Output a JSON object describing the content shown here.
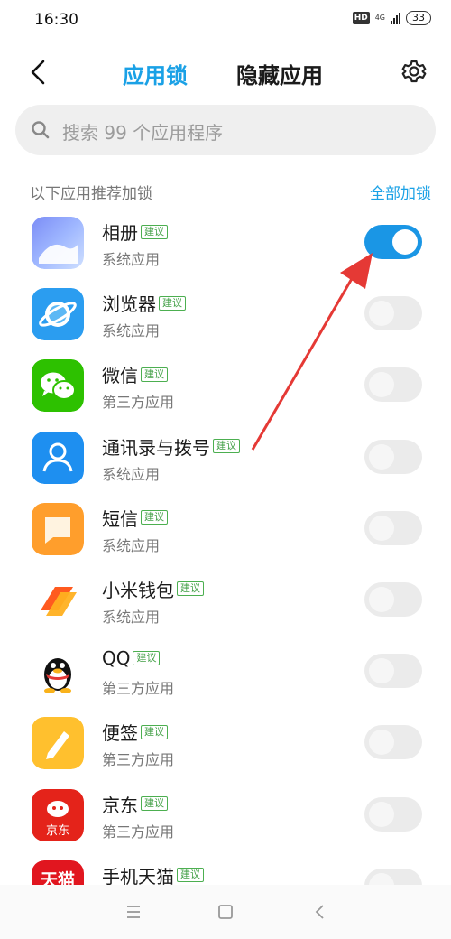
{
  "status_bar": {
    "time": "16:30",
    "hd": "HD",
    "network": "4G",
    "battery": "33"
  },
  "header": {
    "tab_applock": "应用锁",
    "tab_hidden": "隐藏应用",
    "icons": [
      "back-arrow-icon",
      "gear-icon"
    ]
  },
  "search": {
    "placeholder": "搜索 99 个应用程序"
  },
  "section": {
    "title": "以下应用推荐加锁",
    "lock_all": "全部加锁"
  },
  "badge_text": "建议",
  "apps": [
    {
      "name": "相册",
      "type": "系统应用",
      "badge": "建议",
      "locked": true
    },
    {
      "name": "浏览器",
      "type": "系统应用",
      "badge": "建议",
      "locked": false
    },
    {
      "name": "微信",
      "type": "第三方应用",
      "badge": "建议",
      "locked": false
    },
    {
      "name": "通讯录与拨号",
      "type": "系统应用",
      "badge": "建议",
      "locked": false
    },
    {
      "name": "短信",
      "type": "系统应用",
      "badge": "建议",
      "locked": false
    },
    {
      "name": "小米钱包",
      "type": "系统应用",
      "badge": "建议",
      "locked": false
    },
    {
      "name": "QQ",
      "type": "第三方应用",
      "badge": "建议",
      "locked": false
    },
    {
      "name": "便签",
      "type": "第三方应用",
      "badge": "建议",
      "locked": false
    },
    {
      "name": "京东",
      "type": "第三方应用",
      "badge": "建议",
      "locked": false
    },
    {
      "name": "手机天猫",
      "type": "",
      "badge": "建议",
      "locked": false
    }
  ],
  "app_icon_labels": {
    "jd": "京东",
    "tmall": "天猫"
  },
  "colors": {
    "accent": "#1aa1e6",
    "toggle_on": "#1a96e5",
    "badge_green": "#43a047",
    "annotation_arrow": "#e53935"
  },
  "nav": {
    "icons": [
      "menu-icon",
      "home-icon",
      "back-icon"
    ]
  }
}
